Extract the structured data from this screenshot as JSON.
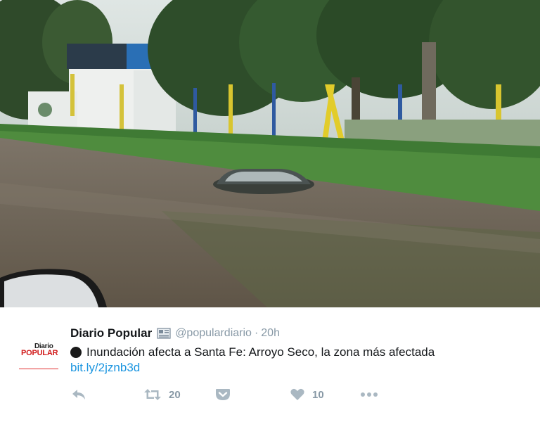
{
  "tweet": {
    "author_name": "Diario Popular",
    "handle": "@populardiario",
    "separator": "·",
    "time": "20h",
    "text": "Inundación afecta a Santa Fe: Arroyo Seco, la zona más afectada",
    "link": "bit.ly/2jznb3d",
    "avatar": {
      "top_text": "Diario",
      "main_text": "POPULAR"
    }
  },
  "actions": {
    "retweet_count": "20",
    "like_count": "10"
  },
  "icons": {
    "reply": "reply-icon",
    "retweet": "retweet-icon",
    "pocket": "pocket-icon",
    "like": "heart-icon",
    "more": "more-icon",
    "newspaper": "newspaper-icon",
    "bullet": "black-circle-icon"
  },
  "colors": {
    "link": "#1b95e0",
    "muted": "#8899a6",
    "text": "#14171a",
    "avatar_red": "#d11a1a"
  }
}
